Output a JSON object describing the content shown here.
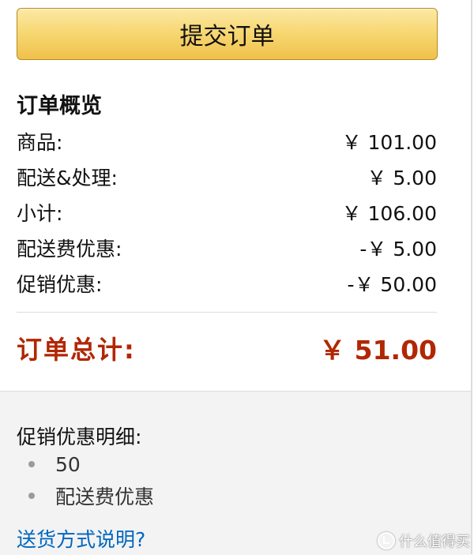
{
  "submit_button": "提交订单",
  "summary": {
    "title": "订单概览",
    "rows": [
      {
        "label": "商品:",
        "amount": "￥ 101.00"
      },
      {
        "label": "配送&处理:",
        "amount": "￥ 5.00"
      },
      {
        "label": "小计:",
        "amount": "￥ 106.00"
      },
      {
        "label": "配送费优惠:",
        "amount": "-￥ 5.00"
      },
      {
        "label": "促销优惠:",
        "amount": "-￥ 50.00"
      }
    ],
    "total_label": "订单总计:",
    "total_amount": "￥ 51.00"
  },
  "promotions": {
    "title": "促销优惠明细:",
    "items": [
      "50",
      "配送费优惠"
    ]
  },
  "help_link": "送货方式说明?",
  "watermark": "什么值得买",
  "colors": {
    "total_red": "#b12704",
    "link_blue": "#0066c0",
    "button_gold": "#f0c14b"
  }
}
